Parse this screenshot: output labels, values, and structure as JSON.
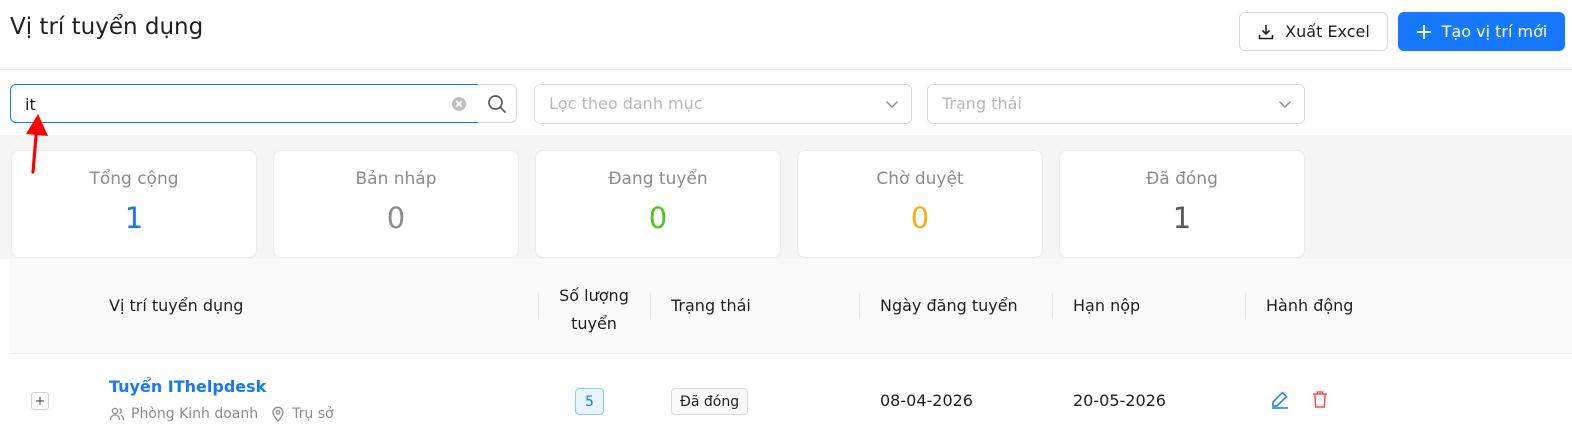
{
  "header": {
    "title": "Vị trí tuyển dụng",
    "export_label": "Xuất Excel",
    "create_label": "Tạo vị trí mới"
  },
  "filters": {
    "search_value": "it",
    "category_placeholder": "Lọc theo danh mục",
    "status_placeholder": "Trạng thái"
  },
  "stats": [
    {
      "label": "Tổng cộng",
      "value": "1",
      "color": "#1677ff"
    },
    {
      "label": "Bản nháp",
      "value": "0",
      "color": "#8c8c8c"
    },
    {
      "label": "Đang tuyển",
      "value": "0",
      "color": "#52c41a"
    },
    {
      "label": "Chờ duyệt",
      "value": "0",
      "color": "#faad14"
    },
    {
      "label": "Đã đóng",
      "value": "1",
      "color": "#595959"
    }
  ],
  "table": {
    "columns": {
      "position": "Vị trí tuyển dụng",
      "quantity_line1": "Số lượng",
      "quantity_line2": "tuyển",
      "status": "Trạng thái",
      "posted_date": "Ngày đăng tuyển",
      "deadline": "Hạn nộp",
      "actions": "Hành động"
    },
    "rows": [
      {
        "title": "Tuyển IThelpdesk",
        "department": "Phòng Kinh doanh",
        "location": "Trụ sở",
        "quantity": "5",
        "status": "Đã đóng",
        "posted_date": "08-04-2026",
        "deadline": "20-05-2026"
      }
    ]
  },
  "colors": {
    "primary": "#1677ff",
    "danger": "#ff4d4f",
    "annotation": "#ff0000"
  }
}
